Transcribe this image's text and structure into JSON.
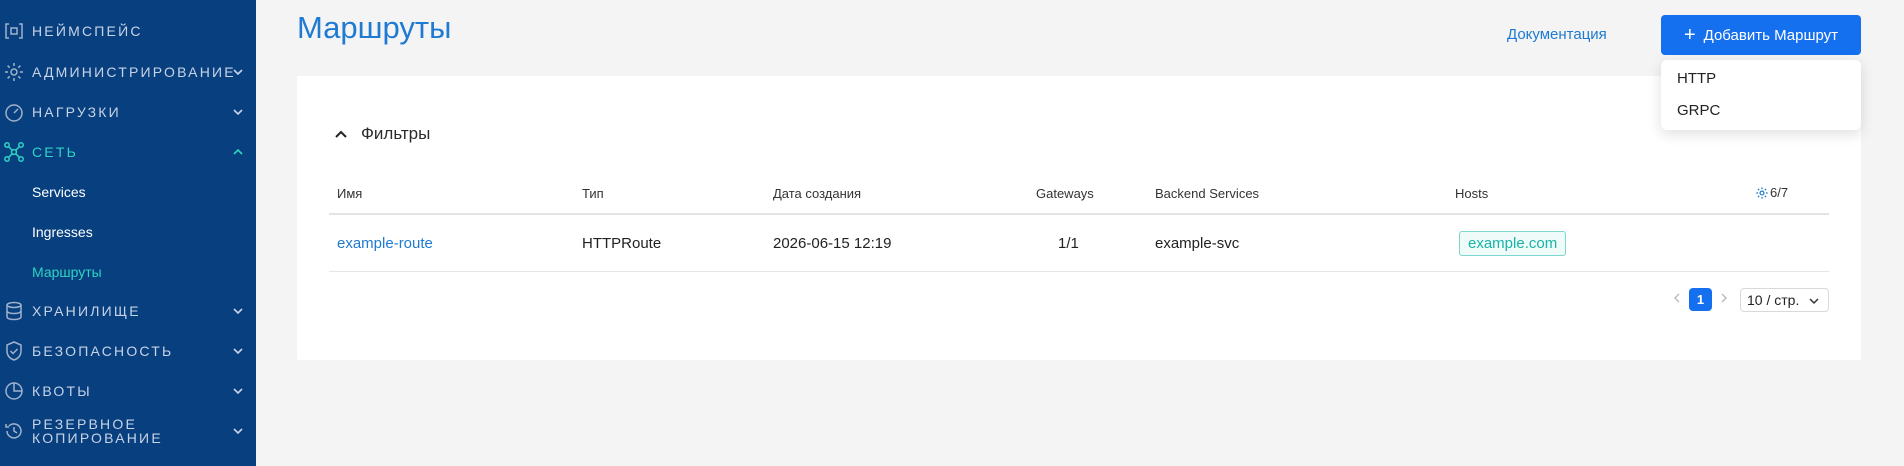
{
  "sidebar": {
    "items": [
      {
        "label": "НЕЙМСПЕЙС",
        "icon": "namespace-icon"
      },
      {
        "label": "АДМИНИСТРИРОВАНИЕ",
        "icon": "gear-icon"
      },
      {
        "label": "НАГРУЗКИ",
        "icon": "gauge-icon"
      },
      {
        "label": "СЕТЬ",
        "icon": "network-icon"
      },
      {
        "label": "ХРАНИЛИЩЕ",
        "icon": "database-icon"
      },
      {
        "label": "БЕЗОПАСНОСТЬ",
        "icon": "shield-icon"
      },
      {
        "label": "КВОТЫ",
        "icon": "pie-icon"
      },
      {
        "label_line1": "РЕЗЕРВНОЕ",
        "label_line2": "КОПИРОВАНИЕ",
        "icon": "backup-icon"
      }
    ],
    "sub_items": [
      "Services",
      "Ingresses",
      "Маршруты"
    ],
    "active_section": "СЕТЬ",
    "active_sub_item": "Маршруты"
  },
  "header": {
    "title": "Маршруты",
    "docs_link": "Документация",
    "add_button": "Добавить Маршрут"
  },
  "add_menu": {
    "options": [
      "HTTP",
      "GRPC"
    ]
  },
  "filters": {
    "label": "Фильтры"
  },
  "table": {
    "columns": [
      "Имя",
      "Тип",
      "Дата создания",
      "Gateways",
      "Backend Services",
      "Hosts"
    ],
    "column_counter": "6/7",
    "rows": [
      {
        "name": "example-route",
        "type": "HTTPRoute",
        "created": "2026-06-15 12:19",
        "gateways": "1/1",
        "backend": "example-svc",
        "host": "example.com"
      }
    ]
  },
  "pagination": {
    "current_page": "1",
    "page_size": "10 / стр."
  },
  "colors": {
    "sidebar_bg": "#083f7f",
    "accent": "#1570ef",
    "link": "#1f7ad1",
    "active": "#2fd3c4"
  }
}
